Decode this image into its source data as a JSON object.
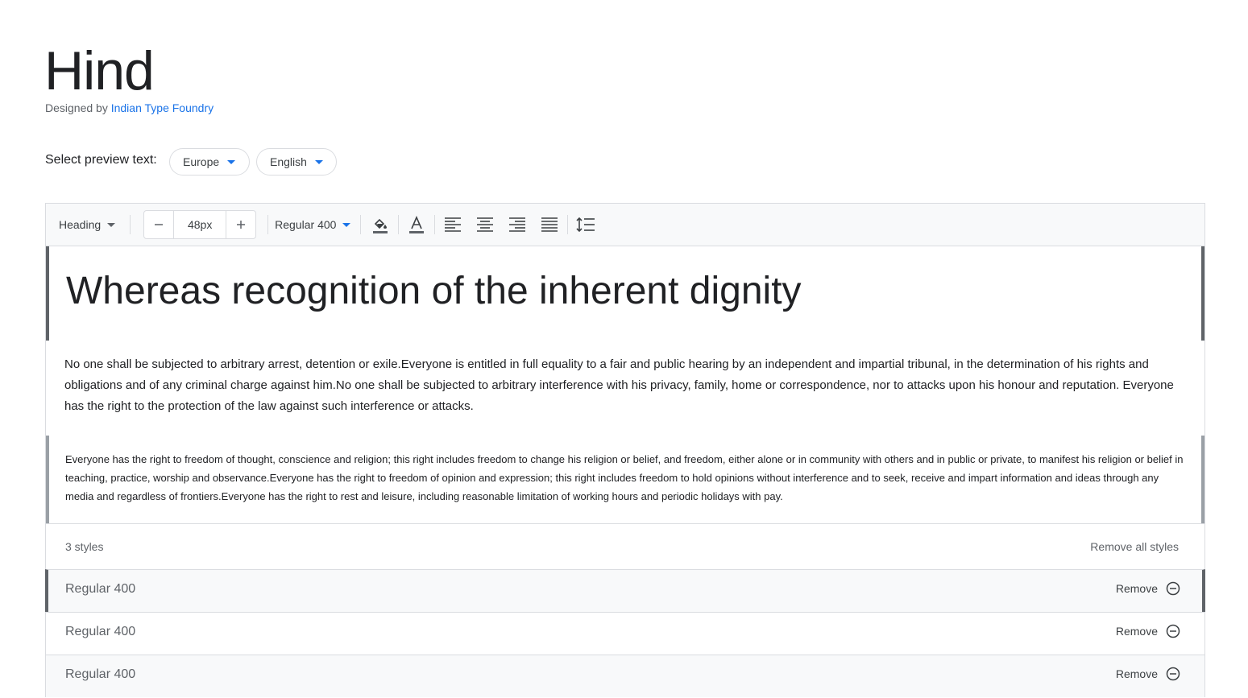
{
  "font": {
    "name": "Hind",
    "designed_by_label": "Designed by",
    "designer": "Indian Type Foundry"
  },
  "preview": {
    "label": "Select preview text:",
    "region": "Europe",
    "language": "English"
  },
  "toolbar": {
    "style": "Heading",
    "size": "48px",
    "weight": "Regular 400",
    "icons": [
      "decrease-icon",
      "increase-icon",
      "fill-color-icon",
      "text-color-icon",
      "align-left-icon",
      "align-center-icon",
      "align-right-icon",
      "align-justify-icon",
      "line-height-icon"
    ]
  },
  "editor": {
    "heading": "Whereas recognition of the inherent dignity",
    "paragraph": "No one shall be subjected to arbitrary arrest, detention or exile.Everyone is entitled in full equality to a fair and public hearing by an independent and impartial tribunal, in the determination of his rights and obligations and of any criminal charge against him.No one shall be subjected to arbitrary interference with his privacy, family, home or correspondence, nor to attacks upon his honour and reputation. Everyone has the right to the protection of the law against such interference or attacks.",
    "small": "Everyone has the right to freedom of thought, conscience and religion; this right includes freedom to change his religion or belief, and freedom, either alone or in community with others and in public or private, to manifest his religion or belief in teaching, practice, worship and observance.Everyone has the right to freedom of opinion and expression; this right includes freedom to hold opinions without interference and to seek, receive and impart information and ideas through any media and regardless of frontiers.Everyone has the right to rest and leisure, including reasonable limitation of working hours and periodic holidays with pay."
  },
  "styles": {
    "count_label": "3 styles",
    "remove_all": "Remove all styles",
    "items": [
      {
        "name": "Regular 400",
        "remove": "Remove"
      },
      {
        "name": "Regular 400",
        "remove": "Remove"
      },
      {
        "name": "Regular 400",
        "remove": "Remove"
      }
    ]
  },
  "colors": {
    "link": "#1a73e8",
    "text": "#202124",
    "muted": "#5f6368",
    "border": "#dadce0"
  }
}
